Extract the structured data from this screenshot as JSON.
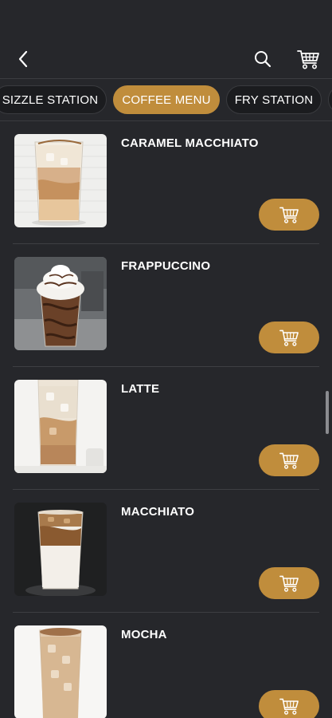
{
  "header": {
    "back_icon": "chevron-left-icon",
    "search_icon": "search-icon",
    "cart_icon": "shopping-cart-icon"
  },
  "tabs": [
    {
      "label": "SIZZLE STATION",
      "active": false
    },
    {
      "label": "COFFEE MENU",
      "active": true
    },
    {
      "label": "FRY STATION",
      "active": false
    },
    {
      "label": "",
      "active": false
    }
  ],
  "items": [
    {
      "name": "CARAMEL MACCHIATO",
      "button_icon": "add-to-cart-icon"
    },
    {
      "name": "FRAPPUCCINO",
      "button_icon": "add-to-cart-icon"
    },
    {
      "name": "LATTE",
      "button_icon": "add-to-cart-icon"
    },
    {
      "name": "MACCHIATO",
      "button_icon": "add-to-cart-icon"
    },
    {
      "name": "MOCHA",
      "button_icon": "add-to-cart-icon"
    }
  ],
  "colors": {
    "background": "#26272b",
    "accent": "#c08d3c",
    "tab_inactive": "#1b1c1f"
  }
}
